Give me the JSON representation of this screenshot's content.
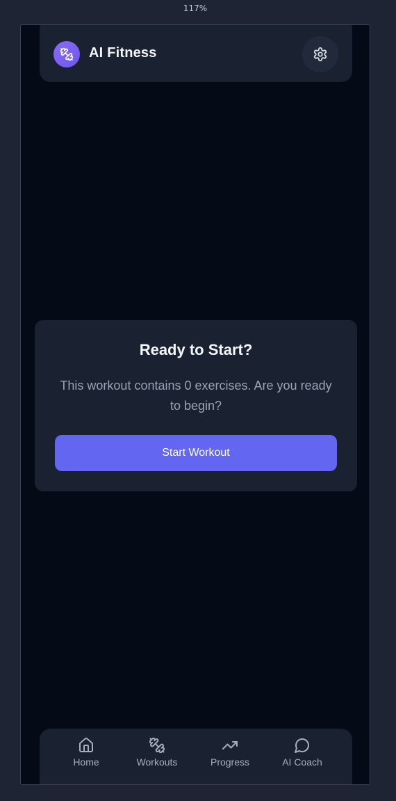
{
  "browser": {
    "zoom": "117%"
  },
  "header": {
    "app_title": "AI Fitness",
    "logo_icon": "dumbbell-icon",
    "settings_icon": "gear-icon"
  },
  "card": {
    "title": "Ready to Start?",
    "description": "This workout contains 0 exercises. Are you ready to begin?",
    "button_label": "Start Workout"
  },
  "nav": {
    "items": [
      {
        "label": "Home",
        "icon": "home-icon"
      },
      {
        "label": "Workouts",
        "icon": "dumbbell-icon"
      },
      {
        "label": "Progress",
        "icon": "trending-up-icon"
      },
      {
        "label": "AI Coach",
        "icon": "chat-bubble-icon"
      }
    ]
  },
  "colors": {
    "page_bg": "#1e2433",
    "app_bg": "#050b16",
    "surface": "#1a2232",
    "accent": "#6366f1",
    "logo_gradient_start": "#8a6cf5",
    "text_primary": "#f4f6fa",
    "text_secondary": "#9aa3b5"
  }
}
